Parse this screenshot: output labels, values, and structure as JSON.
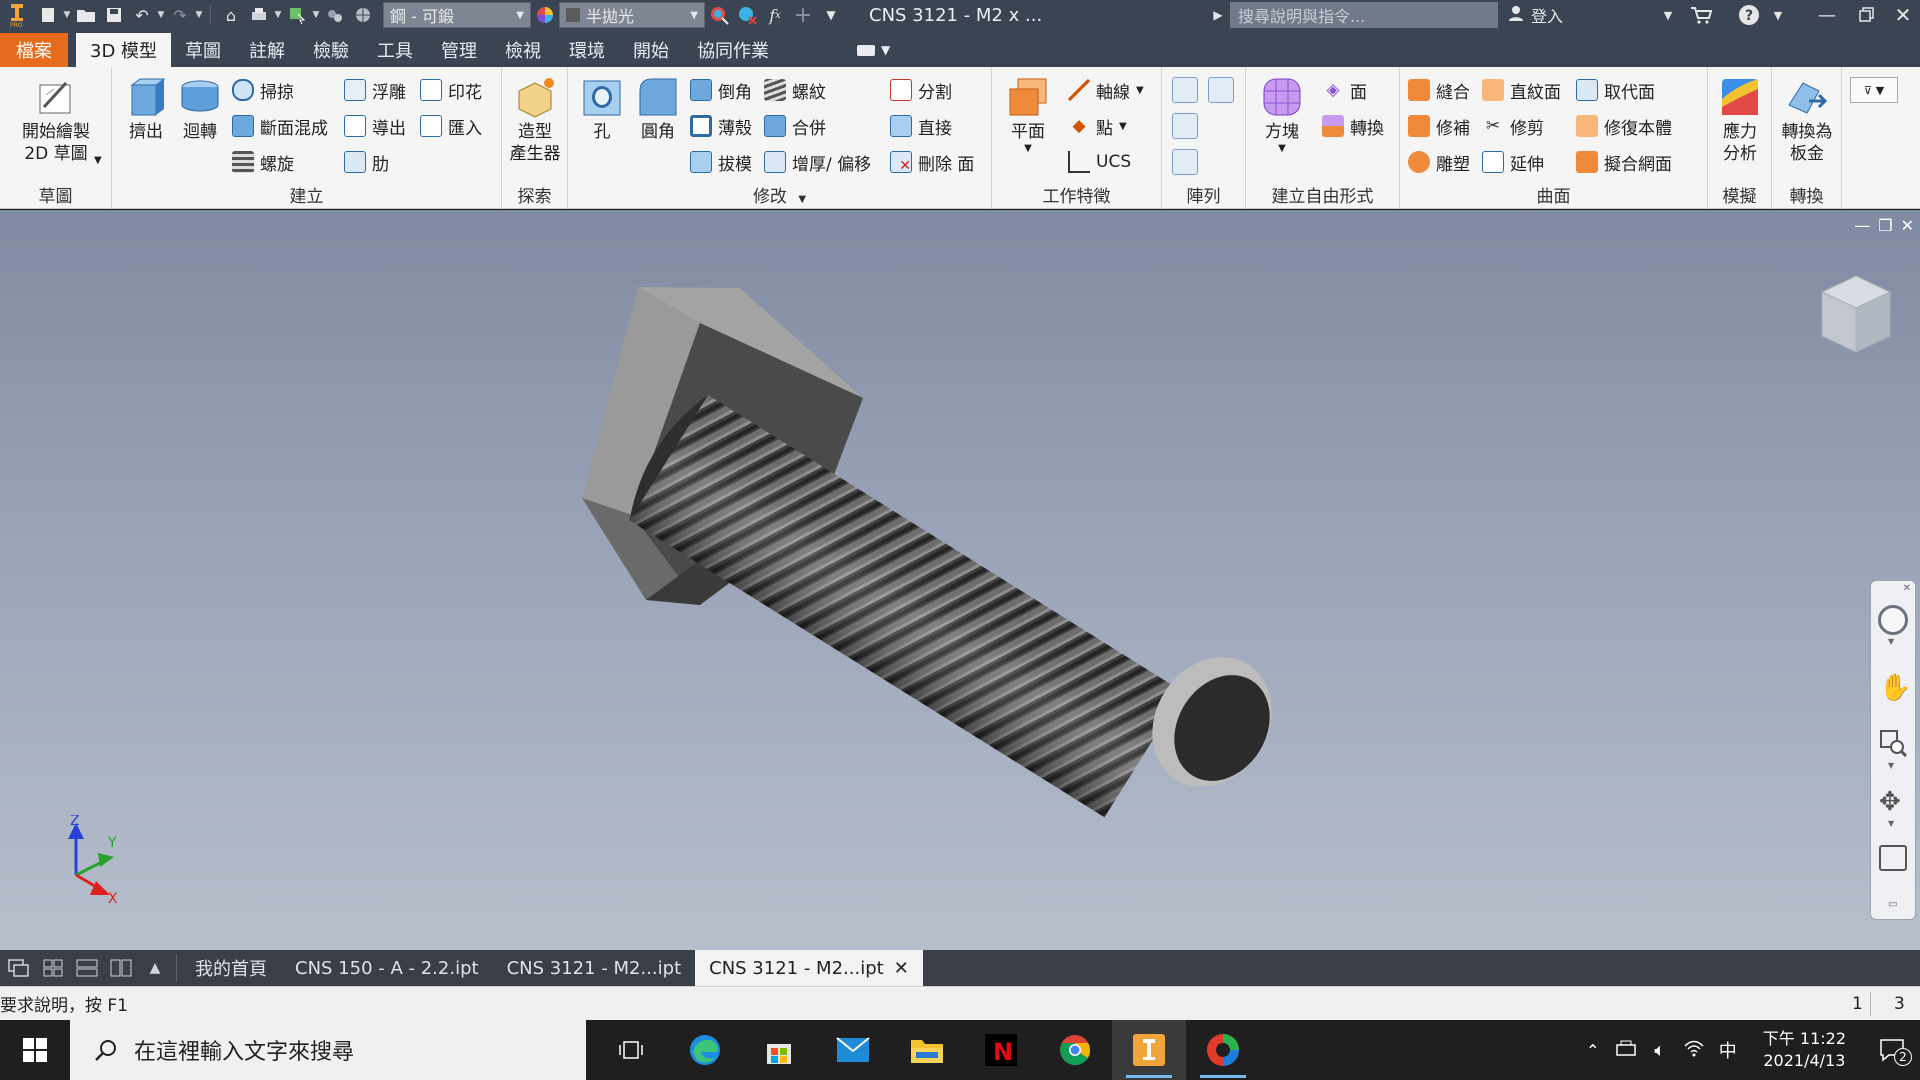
{
  "titlebar": {
    "material_value": "鋼 - 可鍛",
    "appearance_value": "半拋光",
    "doc_title": "CNS 3121 - M2 x ...",
    "search_placeholder": "搜尋說明與指令...",
    "signin_label": "登入"
  },
  "menu": {
    "tabs": [
      "檔案",
      "3D 模型",
      "草圖",
      "註解",
      "檢驗",
      "工具",
      "管理",
      "檢視",
      "環境",
      "開始",
      "協同作業"
    ],
    "active_index": 1
  },
  "ribbon": {
    "panels": {
      "sketch": "草圖",
      "create": "建立",
      "explore": "探索",
      "modify": "修改",
      "work_features": "工作特徵",
      "pattern": "陣列",
      "freeform": "建立自由形式",
      "surface": "曲面",
      "simulation": "模擬",
      "convert": "轉換"
    },
    "buttons": {
      "start_sketch_1": "開始繪製",
      "start_sketch_2": "2D 草圖",
      "extrude": "擠出",
      "revolve": "迴轉",
      "sweep": "掃掠",
      "loft": "斷面混成",
      "coil": "螺旋",
      "emboss": "浮雕",
      "derive": "導出",
      "rib": "肋",
      "decal": "印花",
      "import": "匯入",
      "shape_gen_1": "造型",
      "shape_gen_2": "產生器",
      "hole": "孔",
      "fillet": "圓角",
      "chamfer": "倒角",
      "shell": "薄殼",
      "draft": "拔模",
      "thread": "螺紋",
      "combine": "合併",
      "thicken": "增厚/ 偏移",
      "split": "分割",
      "direct": "直接",
      "delete_face": "刪除 面",
      "plane": "平面",
      "axis": "軸線",
      "point": "點",
      "ucs": "UCS",
      "box": "方塊",
      "face": "面",
      "convert": "轉換",
      "stitch": "縫合",
      "ruled": "直紋面",
      "replace_face": "取代面",
      "patch": "修補",
      "trim": "修剪",
      "repair": "修復本體",
      "sculpt": "雕塑",
      "extend": "延伸",
      "fit_mesh": "擬合網面",
      "stress_1": "應力",
      "stress_2": "分析",
      "sheet_1": "轉換為",
      "sheet_2": "板金"
    }
  },
  "viewport": {
    "model": "hex-bolt",
    "triad_labels": {
      "z": "Z",
      "y": "Y",
      "x": "X"
    },
    "colors": {
      "bg_top": "#7f8ba2",
      "bg_bottom": "#b7bfcc",
      "x": "#e0201c",
      "y": "#27a22a",
      "z": "#2541d8"
    }
  },
  "doctabs": {
    "tabs": [
      "我的首頁",
      "CNS 150 - A - 2.2.ipt",
      "CNS 3121 - M2...ipt",
      "CNS 3121 - M2...ipt"
    ],
    "active_index": 3
  },
  "statusbar": {
    "help": "要求說明，按 F1",
    "count_a": "1",
    "count_b": "3"
  },
  "taskbar": {
    "search_placeholder": "在這裡輸入文字來搜尋",
    "time": "下午 11:22",
    "date": "2021/4/13",
    "ime": "中",
    "notification_count": "2"
  },
  "accent": {
    "file_tab": "#e66b1c",
    "titlebar": "#3b4453"
  }
}
